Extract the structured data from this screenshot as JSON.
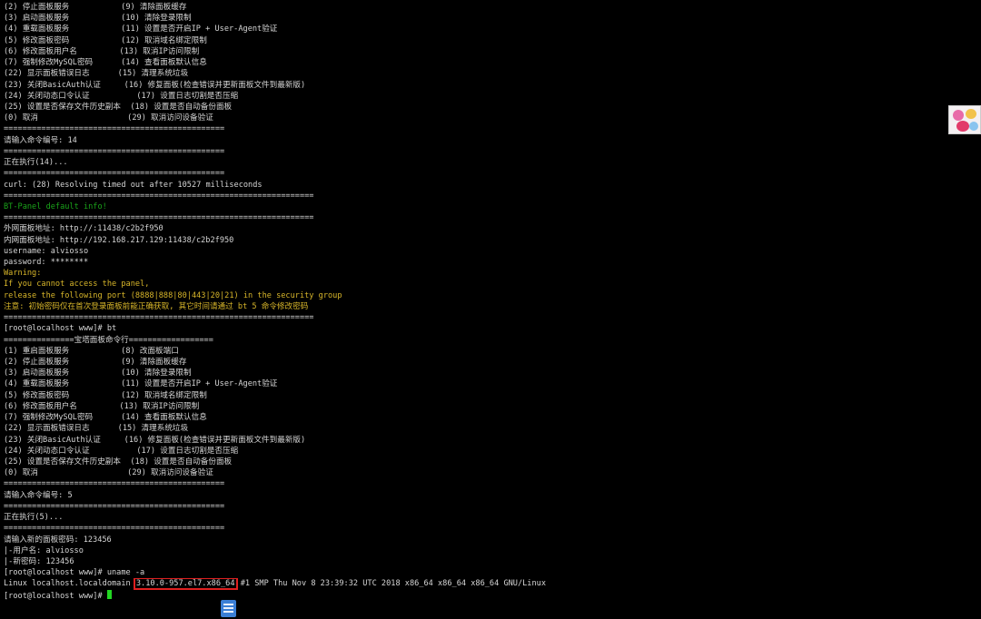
{
  "colors": {
    "background": "#000000",
    "text": "#d6d6d6",
    "green": "#1aa31a",
    "yellow": "#d8b62a",
    "highlight_box": "#e02020",
    "cursor": "#22d622"
  },
  "icons": {
    "thumbnail": "sticker-thumbnail-icon",
    "document": "document-icon"
  },
  "terminal": {
    "lines": [
      [
        {
          "t": "(2) 停止面板服务           (9) 清除面板缓存"
        }
      ],
      [
        {
          "t": "(3) 启动面板服务           (10) 清除登录限制"
        }
      ],
      [
        {
          "t": "(4) 重载面板服务           (11) 设置是否开启IP + User-Agent验证"
        }
      ],
      [
        {
          "t": "(5) 修改面板密码           (12) 取消域名绑定限制"
        }
      ],
      [
        {
          "t": "(6) 修改面板用户名         (13) 取消IP访问限制"
        }
      ],
      [
        {
          "t": "(7) 强制修改MySQL密码      (14) 查看面板默认信息"
        }
      ],
      [
        {
          "t": "(22) 显示面板错误日志      (15) 清理系统垃圾"
        }
      ],
      [
        {
          "t": "(23) 关闭BasicAuth认证     (16) 修复面板(检查错误并更新面板文件到最新版)"
        }
      ],
      [
        {
          "t": "(24) 关闭动态口令认证          (17) 设置日志切割是否压缩"
        }
      ],
      [
        {
          "t": "(25) 设置是否保存文件历史副本  (18) 设置是否自动备份面板"
        }
      ],
      [
        {
          "t": "(0) 取消                   (29) 取消访问设备验证"
        }
      ],
      [
        {
          "t": "==============================================="
        }
      ],
      [
        {
          "t": "请输入命令编号: 14"
        }
      ],
      [
        {
          "t": "==============================================="
        }
      ],
      [
        {
          "t": "正在执行(14)..."
        }
      ],
      [
        {
          "t": "==============================================="
        }
      ],
      [
        {
          "t": "curl: (28) Resolving timed out after 10527 milliseconds"
        }
      ],
      [
        {
          "t": "=================================================================="
        }
      ],
      [
        {
          "t": "BT-Panel default info!",
          "c": "green"
        }
      ],
      [
        {
          "t": "=================================================================="
        }
      ],
      [
        {
          "t": "外网面板地址: http://:11438/c2b2f950"
        }
      ],
      [
        {
          "t": "内网面板地址: http://192.168.217.129:11438/c2b2f950"
        }
      ],
      [
        {
          "t": "username: alviosso"
        }
      ],
      [
        {
          "t": "password: ********"
        }
      ],
      [
        {
          "t": "Warning:",
          "c": "yellow"
        }
      ],
      [
        {
          "t": "If you cannot access the panel,",
          "c": "yellow"
        }
      ],
      [
        {
          "t": "release the following port (8888|888|80|443|20|21) in the security group",
          "c": "yellow"
        }
      ],
      [
        {
          "t": "注意: 初始密码仅在首次登录面板前能正确获取, 其它时间请通过 bt 5 命令修改密码",
          "c": "yellow"
        }
      ],
      [
        {
          "t": "=================================================================="
        }
      ],
      [
        {
          "t": "[root@localhost www]# bt"
        }
      ],
      [
        {
          "t": "===============宝塔面板命令行=================="
        }
      ],
      [
        {
          "t": "(1) 重启面板服务           (8) 改面板端口"
        }
      ],
      [
        {
          "t": "(2) 停止面板服务           (9) 清除面板缓存"
        }
      ],
      [
        {
          "t": "(3) 启动面板服务           (10) 清除登录限制"
        }
      ],
      [
        {
          "t": "(4) 重载面板服务           (11) 设置是否开启IP + User-Agent验证"
        }
      ],
      [
        {
          "t": "(5) 修改面板密码           (12) 取消域名绑定限制"
        }
      ],
      [
        {
          "t": "(6) 修改面板用户名         (13) 取消IP访问限制"
        }
      ],
      [
        {
          "t": "(7) 强制修改MySQL密码      (14) 查看面板默认信息"
        }
      ],
      [
        {
          "t": "(22) 显示面板错误日志      (15) 清理系统垃圾"
        }
      ],
      [
        {
          "t": "(23) 关闭BasicAuth认证     (16) 修复面板(检查错误并更新面板文件到最新版)"
        }
      ],
      [
        {
          "t": "(24) 关闭动态口令认证          (17) 设置日志切割是否压缩"
        }
      ],
      [
        {
          "t": "(25) 设置是否保存文件历史副本  (18) 设置是否自动备份面板"
        }
      ],
      [
        {
          "t": "(0) 取消                   (29) 取消访问设备验证"
        }
      ],
      [
        {
          "t": "==============================================="
        }
      ],
      [
        {
          "t": "请输入命令编号: 5"
        }
      ],
      [
        {
          "t": "==============================================="
        }
      ],
      [
        {
          "t": "正在执行(5)..."
        }
      ],
      [
        {
          "t": "==============================================="
        }
      ],
      [
        {
          "t": "请输入新的面板密码: 123456"
        }
      ],
      [
        {
          "t": "|-用户名: alviosso"
        }
      ],
      [
        {
          "t": "|-新密码: 123456"
        }
      ],
      [
        {
          "t": "[root@localhost www]# uname -a"
        }
      ],
      [
        {
          "t": "Linux localhost.localdomain "
        },
        {
          "t": "3.10.0-957.el7.x86_64",
          "h": true
        },
        {
          "t": " #1 SMP Thu Nov 8 23:39:32 UTC 2018 x86_64 x86_64 x86_64 GNU/Linux"
        }
      ],
      [
        {
          "t": "[root@localhost www]# "
        },
        {
          "cursor": true
        }
      ]
    ]
  }
}
